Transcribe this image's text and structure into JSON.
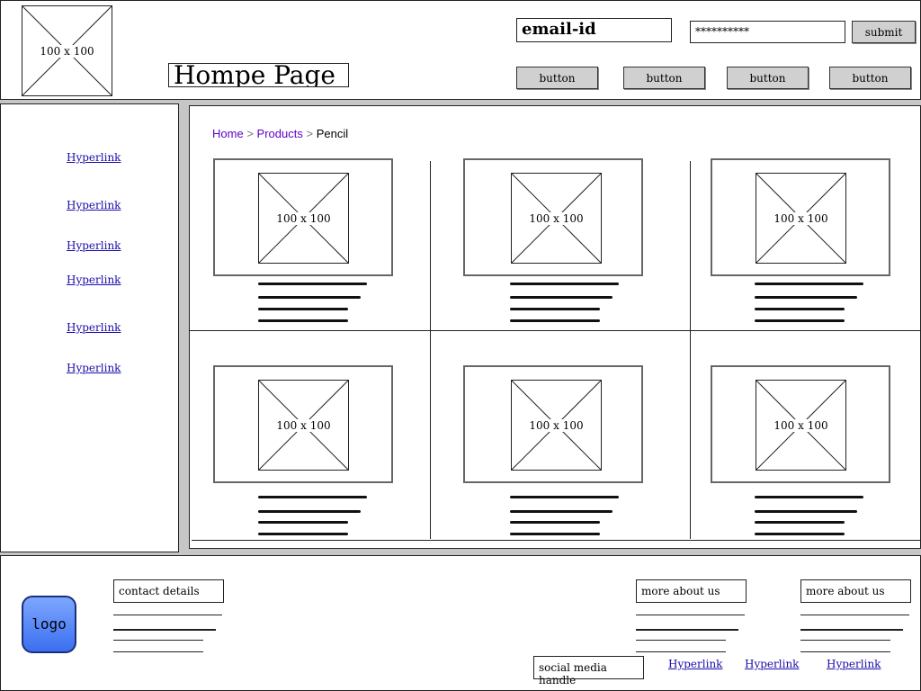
{
  "header": {
    "logo_placeholder": "100 x 100",
    "title": "Hompe Page",
    "email_value": "email-id",
    "password_value": "**********",
    "submit_label": "submit",
    "nav_buttons": [
      "button",
      "button",
      "button",
      "button"
    ]
  },
  "sidebar": {
    "links": [
      "Hyperlink",
      "Hyperlink",
      "Hyperlink",
      "Hyperlink",
      "Hyperlink",
      "Hyperlink"
    ]
  },
  "breadcrumb": {
    "home": "Home",
    "products": "Products",
    "current": "Pencil",
    "separator": ">"
  },
  "products": [
    {
      "image": "100 x 100"
    },
    {
      "image": "100 x 100"
    },
    {
      "image": "100 x 100"
    },
    {
      "image": "100 x 100"
    },
    {
      "image": "100 x 100"
    },
    {
      "image": "100 x 100"
    }
  ],
  "footer": {
    "logo": "logo",
    "contact_label": "contact details",
    "more_about_1": "more about us",
    "more_about_2": "more about us",
    "social_label": "social media handle",
    "links": [
      "Hyperlink",
      "Hyperlink",
      "Hyperlink"
    ]
  },
  "colors": {
    "link": "#1a0dab",
    "button_bg": "#d0d0d0",
    "logo_gradient_top": "#7ea6ff",
    "logo_gradient_bottom": "#3a6ff0"
  }
}
